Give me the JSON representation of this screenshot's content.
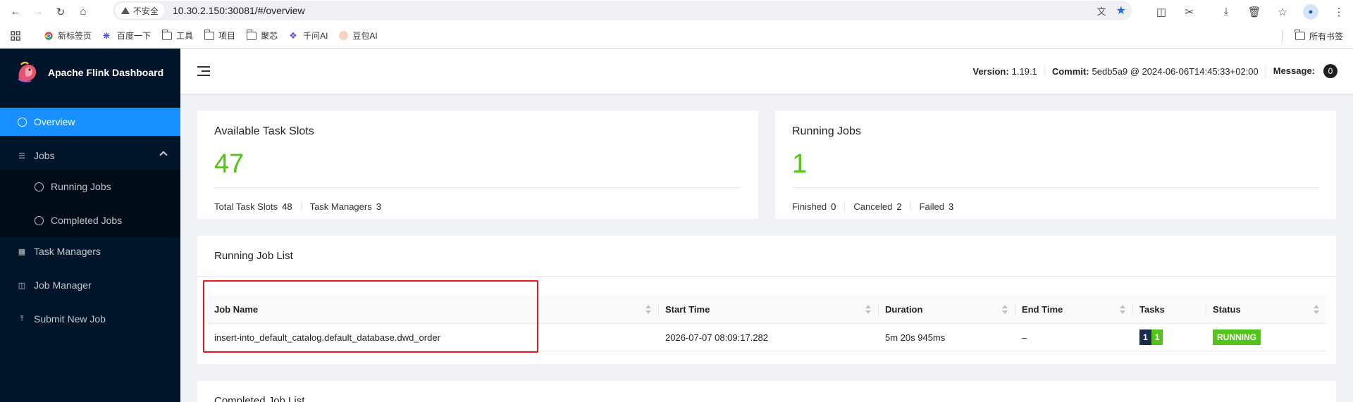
{
  "browser": {
    "insecure_label": "不安全",
    "url": "10.30.2.150:30081/#/overview",
    "bookmarks": [
      "新标签页",
      "百度一下",
      "工具",
      "项目",
      "聚芯",
      "千问AI",
      "豆包AI"
    ],
    "bookmarks_right": "所有书签"
  },
  "sidebar": {
    "brand": "Apache Flink Dashboard",
    "items": {
      "overview": "Overview",
      "jobs": "Jobs",
      "running_jobs": "Running Jobs",
      "completed_jobs": "Completed Jobs",
      "task_managers": "Task Managers",
      "job_manager": "Job Manager",
      "submit_new_job": "Submit New Job"
    }
  },
  "header": {
    "version_label": "Version:",
    "version": "1.19.1",
    "commit_label": "Commit:",
    "commit": "5edb5a9 @ 2024-06-06T14:45:33+02:00",
    "message_label": "Message:",
    "message_count": "0"
  },
  "slots_card": {
    "title": "Available Task Slots",
    "value": "47",
    "total_label": "Total Task Slots",
    "total": "48",
    "tm_label": "Task Managers",
    "tm": "3"
  },
  "jobs_card": {
    "title": "Running Jobs",
    "value": "1",
    "finished_label": "Finished",
    "finished": "0",
    "canceled_label": "Canceled",
    "canceled": "2",
    "failed_label": "Failed",
    "failed": "3"
  },
  "running_list": {
    "title": "Running Job List",
    "columns": [
      "Job Name",
      "Start Time",
      "Duration",
      "End Time",
      "Tasks",
      "Status"
    ],
    "rows": [
      {
        "name": "insert-into_default_catalog.default_database.dwd_order",
        "start": "2026-07-07 08:09:17.282",
        "duration": "5m 20s 945ms",
        "end": "–",
        "tasks": [
          "1",
          "1"
        ],
        "status": "RUNNING"
      }
    ]
  },
  "completed_list": {
    "title": "Completed Job List"
  },
  "colors": {
    "sidebar_bg": "#001529",
    "active": "#1890ff",
    "success": "#52c41a",
    "task_created": "#1a2b4c"
  }
}
